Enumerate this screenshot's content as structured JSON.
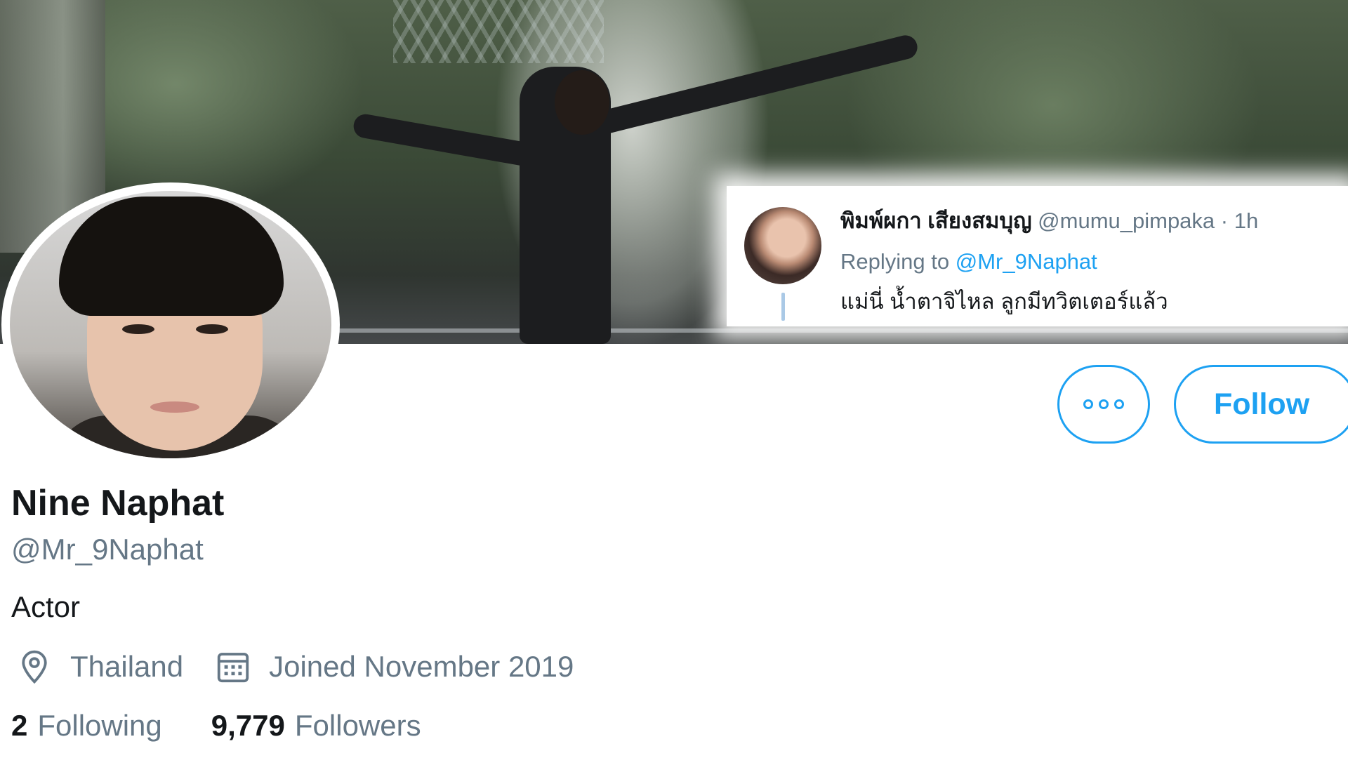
{
  "profile": {
    "display_name": "Nine Naphat",
    "screen_name": "@Mr_9Naphat",
    "bio": "Actor",
    "location": "Thailand",
    "location_icon": "location-pin-icon",
    "joined": "Joined November 2019",
    "joined_icon": "calendar-icon",
    "following_count": "2",
    "following_label": "Following",
    "followers_count": "9,779",
    "followers_label": "Followers"
  },
  "actions": {
    "more_icon": "more-options-icon",
    "follow_label": "Follow"
  },
  "embedded_tweet": {
    "author_name": "พิมพ์ผกา เสียงสมบุญ",
    "author_handle": "@mumu_pimpaka",
    "separator": "·",
    "time": "1h",
    "replying_prefix": "Replying to",
    "replying_handle": "@Mr_9Naphat",
    "text": "แม่นี่ น้ำตาจิไหล ลูกมีทวิตเตอร์แล้ว"
  },
  "colors": {
    "accent": "#1da1f2",
    "secondary_text": "#657786",
    "primary_text": "#14171a",
    "background": "#ffffff"
  }
}
